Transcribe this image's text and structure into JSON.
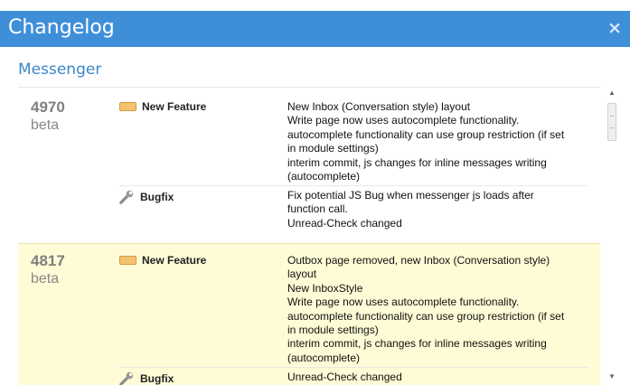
{
  "window": {
    "title": "Changelog",
    "close_label": "×"
  },
  "section": {
    "title": "Messenger"
  },
  "versions": [
    {
      "number": "4970",
      "channel": "beta",
      "entries": [
        {
          "type": "New Feature",
          "icon": "new-badge-icon",
          "lines": [
            "New Inbox (Conversation style) layout",
            "Write page now uses autocomplete functionality.",
            "autocomplete functionality can use group restriction (if set",
            "in module settings)",
            "interim commit, js changes for inline messages writing",
            "(autocomplete)"
          ]
        },
        {
          "type": "Bugfix",
          "icon": "wrench-icon",
          "lines": [
            "Fix potential JS Bug when messenger js loads after",
            "function call.",
            "Unread-Check changed"
          ]
        }
      ]
    },
    {
      "number": "4817",
      "channel": "beta",
      "entries": [
        {
          "type": "New Feature",
          "icon": "new-badge-icon",
          "lines": [
            "Outbox page removed, new Inbox (Conversation style)",
            "layout",
            "New InboxStyle",
            "Write page now uses autocomplete functionality.",
            "autocomplete functionality can use group restriction (if set",
            "in module settings)",
            "interim commit, js changes for inline messages writing",
            "(autocomplete)"
          ]
        },
        {
          "type": "Bugfix",
          "icon": "wrench-icon",
          "lines": [
            "Unread-Check changed"
          ]
        }
      ]
    }
  ],
  "colors": {
    "title_bar": "#3f8fd8",
    "section_title": "#3e86c8",
    "highlight_row": "#fffbd6"
  }
}
